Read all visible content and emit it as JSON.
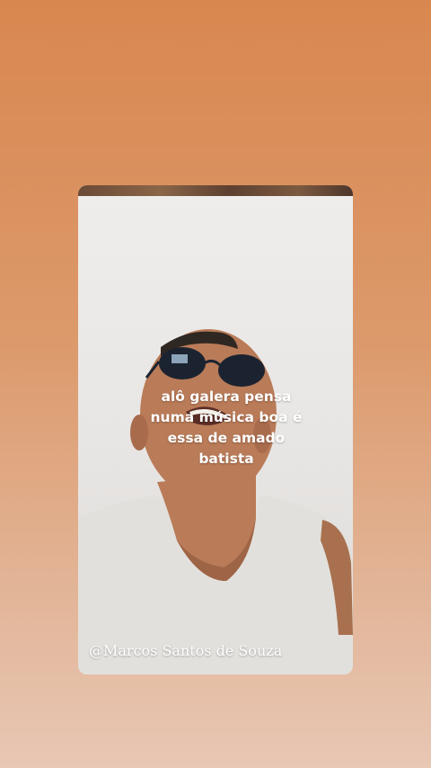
{
  "story": {
    "caption_lines": [
      "alô galera pensa",
      "numa música boa é",
      "essa de amado",
      "batista"
    ],
    "watermark": "@Marcos Santos de Souza"
  },
  "colors": {
    "background_top": "#d9874f",
    "background_bottom": "#e8c7b4",
    "caption_text": "#ffffff"
  }
}
